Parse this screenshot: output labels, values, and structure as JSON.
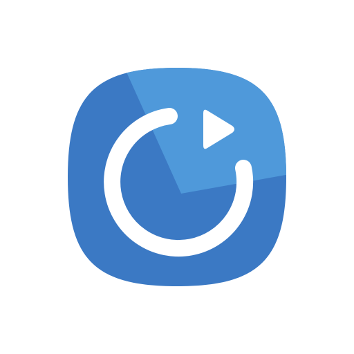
{
  "icon": {
    "name": "replay-icon",
    "colors": {
      "background": "#ffffff",
      "tile_base": "#3b79c4",
      "tile_highlight": "#4f99da",
      "glyph": "#ffffff"
    }
  }
}
